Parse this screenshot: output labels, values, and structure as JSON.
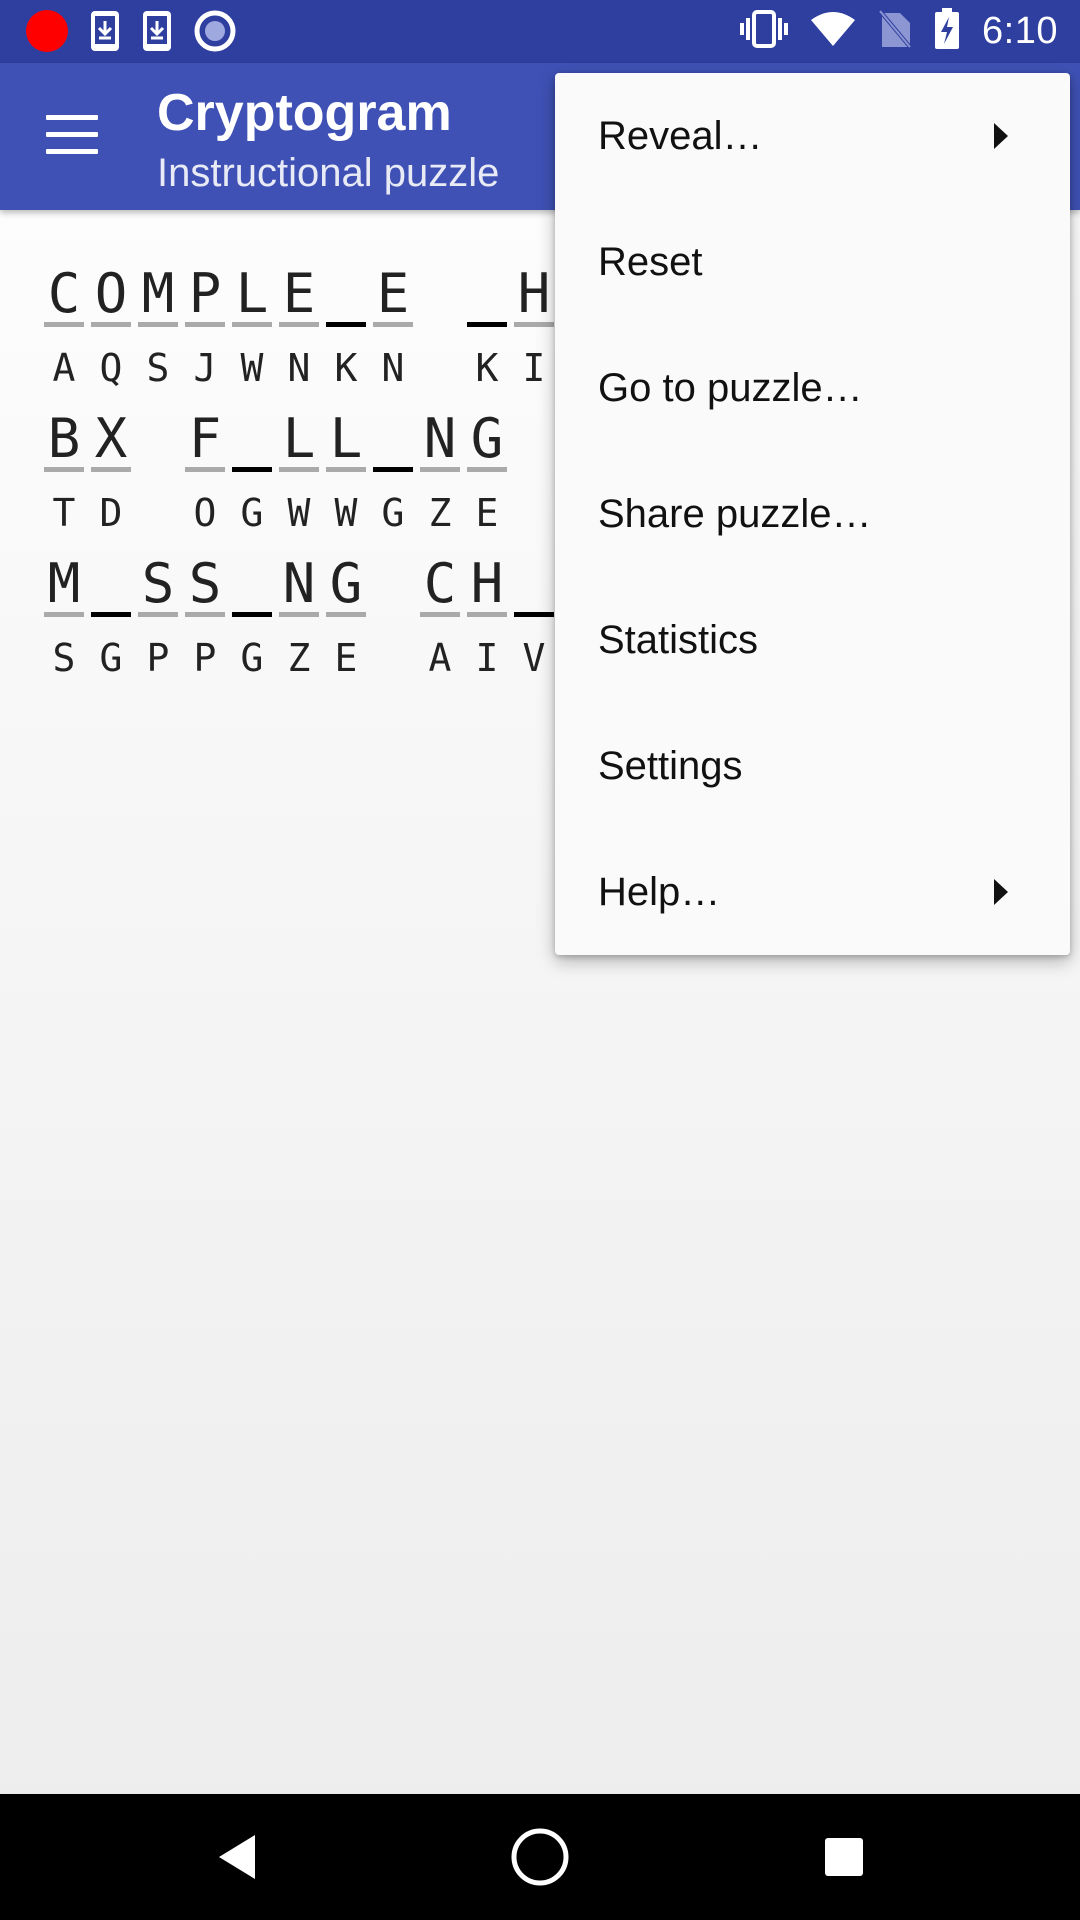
{
  "status_bar": {
    "time": "6:10",
    "left_icons": [
      "record-icon",
      "download-icon",
      "download-icon",
      "disc-icon"
    ],
    "right_icons": [
      "vibrate-icon",
      "wifi-icon",
      "no-sim-icon",
      "battery-charging-icon"
    ]
  },
  "app_bar": {
    "title": "Cryptogram",
    "subtitle": "Instructional puzzle",
    "menu_icon": "hamburger-menu-icon"
  },
  "puzzle": {
    "lines": [
      [
        {
          "plain": [
            "C",
            "O",
            "M",
            "P",
            "L",
            "E",
            "",
            "E"
          ],
          "cipher": [
            "A",
            "Q",
            "S",
            "J",
            "W",
            "N",
            "K",
            "N"
          ]
        },
        {
          "plain": [
            "",
            "H"
          ],
          "cipher": [
            "K",
            "I"
          ]
        }
      ],
      [
        {
          "plain": [
            "B",
            "X"
          ],
          "cipher": [
            "T",
            "D"
          ]
        },
        {
          "plain": [
            "F",
            "",
            "L",
            "L",
            "",
            "N",
            "G"
          ],
          "cipher": [
            "O",
            "G",
            "W",
            "W",
            "G",
            "Z",
            "E"
          ]
        }
      ],
      [
        {
          "plain": [
            "M",
            "",
            "S",
            "S",
            "",
            "N",
            "G"
          ],
          "cipher": [
            "S",
            "G",
            "P",
            "P",
            "G",
            "Z",
            "E"
          ]
        },
        {
          "plain": [
            "C",
            "H",
            ""
          ],
          "cipher": [
            "A",
            "I",
            "V"
          ]
        }
      ]
    ]
  },
  "overflow_menu": {
    "items": [
      {
        "label": "Reveal…",
        "has_submenu": true
      },
      {
        "label": "Reset",
        "has_submenu": false
      },
      {
        "label": "Go to puzzle…",
        "has_submenu": false
      },
      {
        "label": "Share puzzle…",
        "has_submenu": false
      },
      {
        "label": "Statistics",
        "has_submenu": false
      },
      {
        "label": "Settings",
        "has_submenu": false
      },
      {
        "label": "Help…",
        "has_submenu": true
      }
    ]
  },
  "nav_bar": {
    "buttons": [
      "back-icon",
      "home-icon",
      "recents-icon"
    ]
  }
}
